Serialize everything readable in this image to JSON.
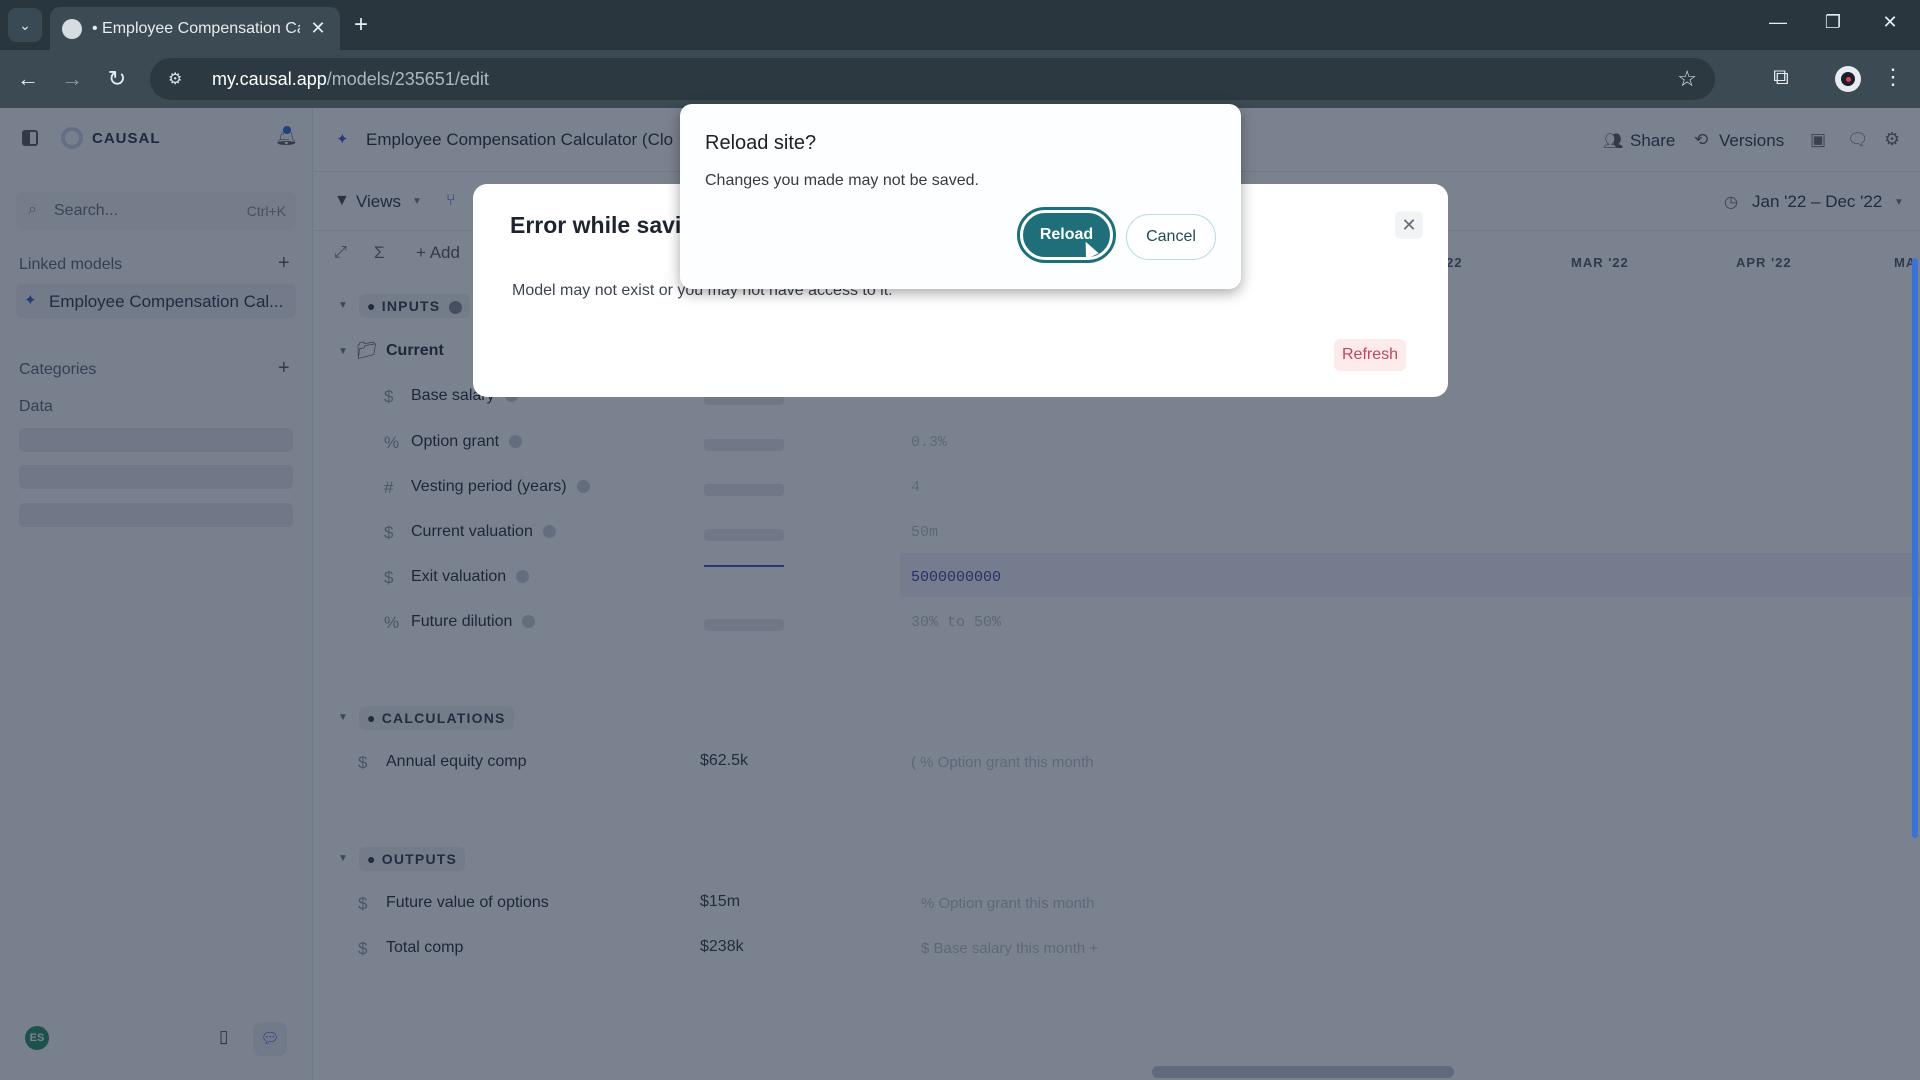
{
  "browser": {
    "tab_title": "• Employee Compensation Calc",
    "url_domain": "my.causal.app",
    "url_path": "/models/235651/edit",
    "icons": [
      "tab-list-icon",
      "close-icon",
      "new-tab-icon",
      "minimize-icon",
      "restore-icon",
      "close-window-icon",
      "back-icon",
      "forward-icon",
      "reload-icon",
      "site-settings-icon",
      "bookmark-star-icon",
      "extensions-icon",
      "profile-icon",
      "menu-icon"
    ]
  },
  "sidebar": {
    "brand": "CAUSAL",
    "search_placeholder": "Search...",
    "search_shortcut": "Ctrl+K",
    "linked_models_label": "Linked models",
    "linked_model_name": "Employee Compensation Cal...",
    "categories_label": "Categories",
    "data_label": "Data",
    "avatar_initials": "ES"
  },
  "header": {
    "model_title": "Employee Compensation Calculator (Clo",
    "share_label": "Share",
    "versions_label": "Versions"
  },
  "toolbar": {
    "views_label": "Views",
    "add_label": "Add",
    "date_range": "Jan '22 – Dec '22"
  },
  "months": [
    "'22",
    "MAR '22",
    "APR '22",
    "MA"
  ],
  "sections": {
    "inputs": "INPUTS",
    "group_current": "Current",
    "inputs_rows": [
      {
        "icon": "$",
        "label": "Base salary",
        "value": ""
      },
      {
        "icon": "%",
        "label": "Option grant",
        "value": "0.3%"
      },
      {
        "icon": "#",
        "label": "Vesting period (years)",
        "value": "4"
      },
      {
        "icon": "$",
        "label": "Current valuation",
        "value": "50m"
      },
      {
        "icon": "$",
        "label": "Exit valuation",
        "value": "5000000000"
      },
      {
        "icon": "%",
        "label": "Future dilution",
        "value": "30% to 50%"
      }
    ],
    "calculations": "CALCULATIONS",
    "calc_rows": [
      {
        "icon": "$",
        "label": "Annual equity comp",
        "value": "$62.5k",
        "formula": "( % Option grant  this month"
      }
    ],
    "outputs": "OUTPUTS",
    "output_rows": [
      {
        "icon": "$",
        "label": "Future value of options",
        "value": "$15m",
        "formula": "% Option grant  this month"
      },
      {
        "icon": "$",
        "label": "Total comp",
        "value": "$238k",
        "formula": "$ Base salary  this month +"
      }
    ]
  },
  "error_modal": {
    "title": "Error while savin",
    "message": "Model may not exist or you may not have access to it.",
    "refresh_label": "Refresh"
  },
  "reload_dialog": {
    "title": "Reload site?",
    "message": "Changes you made may not be saved.",
    "reload_label": "Reload",
    "cancel_label": "Cancel"
  },
  "colors": {
    "accent": "#1f6f7a",
    "danger": "#c2465a",
    "avatar": "#1f8a5f"
  }
}
